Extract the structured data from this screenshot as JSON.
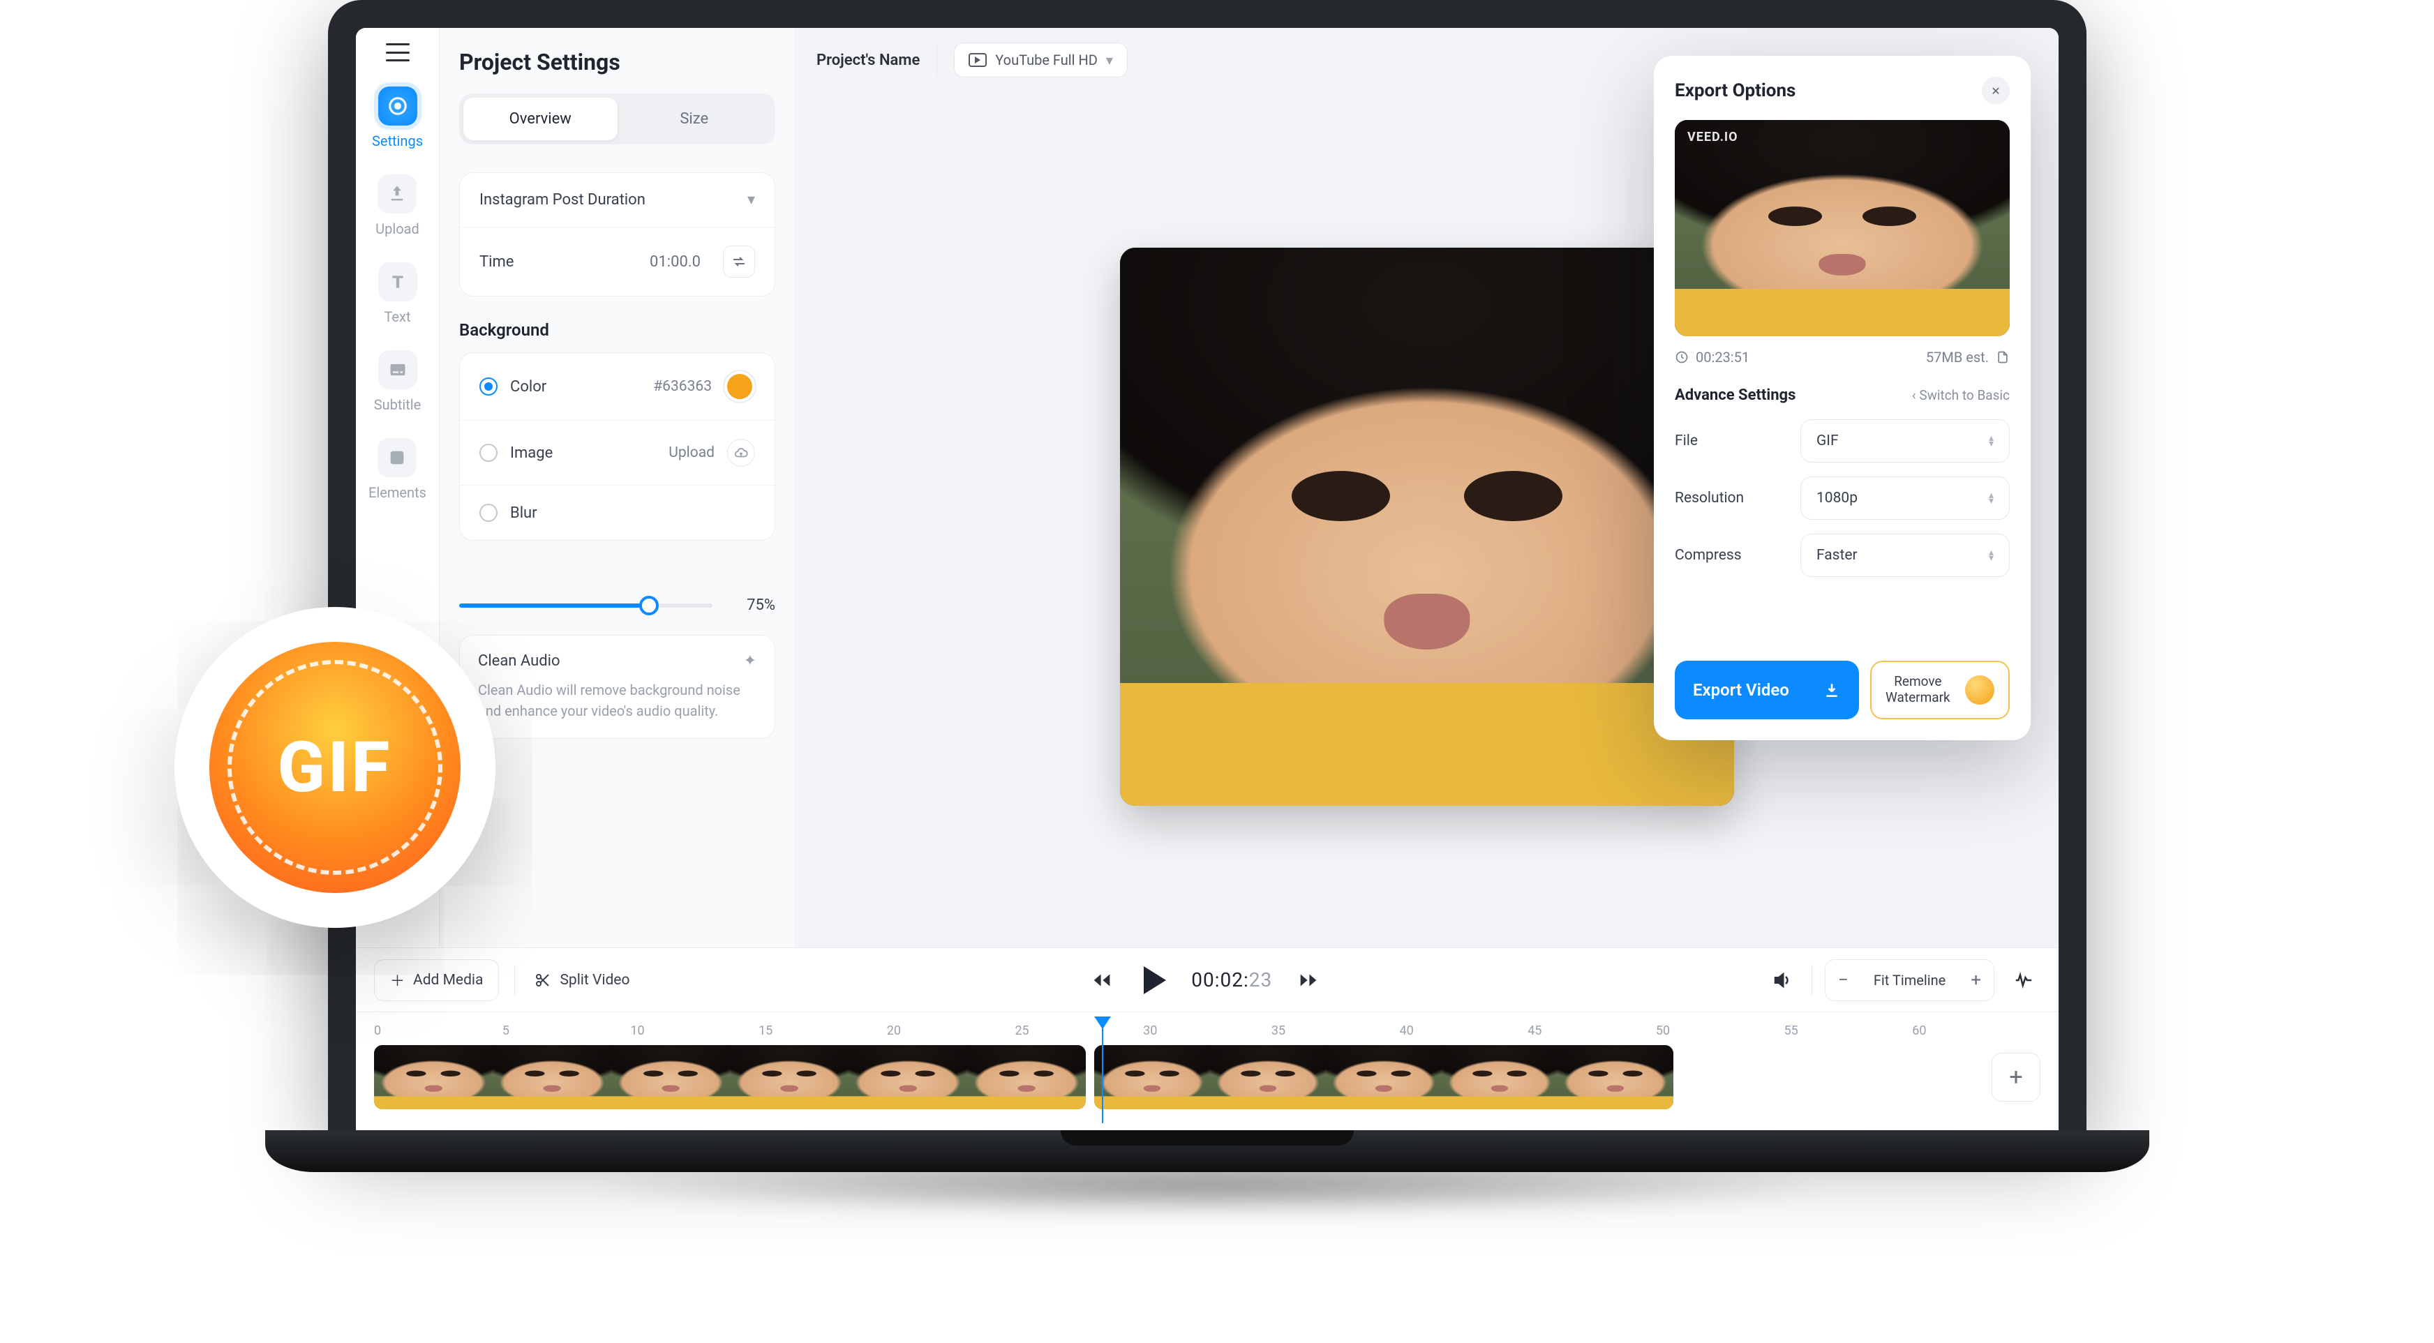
{
  "gif_badge": "GIF",
  "rail": {
    "items": [
      {
        "key": "settings",
        "label": "Settings",
        "active": true
      },
      {
        "key": "upload",
        "label": "Upload"
      },
      {
        "key": "text",
        "label": "Text"
      },
      {
        "key": "subtitle",
        "label": "Subtitle"
      },
      {
        "key": "elements",
        "label": "Elements"
      }
    ]
  },
  "sidebar": {
    "title": "Project Settings",
    "tabs": {
      "overview": "Overview",
      "size": "Size",
      "active": "overview"
    },
    "duration_preset": "Instagram Post Duration",
    "time_label": "Time",
    "time_value": "01:00.0",
    "background": {
      "title": "Background",
      "color_label": "Color",
      "color_hex": "#636363",
      "image_label": "Image",
      "image_action": "Upload",
      "blur_label": "Blur"
    },
    "opacity_value": "75%",
    "clean_audio": {
      "label": "Clean Audio",
      "desc": "Clean Audio will remove background noise and enhance your video's audio quality."
    }
  },
  "header": {
    "project_name": "Project's Name",
    "preset_label": "YouTube Full HD"
  },
  "controls": {
    "add_media": "Add Media",
    "split_video": "Split Video",
    "timecode_main": "00:02:",
    "timecode_ms": "23",
    "fit_label": "Fit Timeline"
  },
  "timeline": {
    "ticks": [
      "0",
      "5",
      "10",
      "15",
      "20",
      "25",
      "30",
      "35",
      "40",
      "45",
      "50",
      "55",
      "60"
    ]
  },
  "export": {
    "title": "Export Options",
    "watermark_text": "VEED.IO",
    "duration": "00:23:51",
    "size_est": "57MB est.",
    "advance_title": "Advance Settings",
    "switch_basic": "Switch to Basic",
    "file_label": "File",
    "file_value": "GIF",
    "res_label": "Resolution",
    "res_value": "1080p",
    "compress_label": "Compress",
    "compress_value": "Faster",
    "export_btn": "Export Video",
    "remove_wm_line1": "Remove",
    "remove_wm_line2": "Watermark"
  }
}
